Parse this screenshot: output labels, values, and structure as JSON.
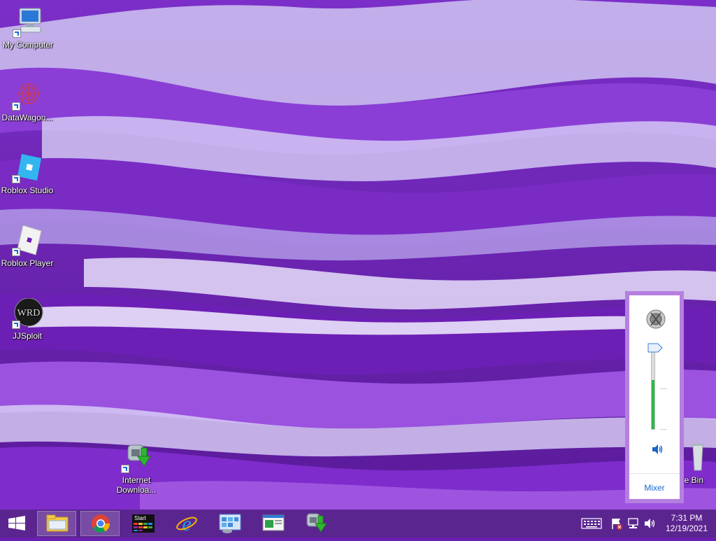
{
  "desktop": {
    "icons": [
      {
        "label": "My Computer",
        "icon": "computer-icon"
      },
      {
        "label": "DataWagon...",
        "icon": "datawagon-icon"
      },
      {
        "label": "Roblox Studio",
        "icon": "roblox-studio-icon"
      },
      {
        "label": "Roblox Player",
        "icon": "roblox-player-icon"
      },
      {
        "label": "JJSploit",
        "icon": "jjsploit-icon"
      },
      {
        "label_line1": "Internet",
        "label_line2": "Downloa...",
        "icon": "internet-download-manager-icon"
      },
      {
        "label": "e Bin",
        "icon": "recycle-bin-icon"
      }
    ]
  },
  "volume": {
    "level": 0.6,
    "mixer_label": "Mixer",
    "accent": "#2db84a"
  },
  "taskbar": {
    "items": [
      {
        "name": "file-explorer",
        "icon": "folder-icon",
        "active": true
      },
      {
        "name": "chrome",
        "icon": "chrome-icon",
        "active": true
      },
      {
        "name": "start-app",
        "icon": "start-app-icon",
        "label": "Start"
      },
      {
        "name": "internet-explorer",
        "icon": "ie-icon"
      },
      {
        "name": "control-panel",
        "icon": "control-panel-icon"
      },
      {
        "name": "window-app",
        "icon": "window-icon"
      },
      {
        "name": "download-manager",
        "icon": "internet-download-manager-icon"
      }
    ],
    "clock": {
      "time": "7:31 PM",
      "date": "12/19/2021"
    }
  },
  "colors": {
    "taskbar": "#5b2590",
    "flyout_border": "#b57fe0",
    "link": "#1a66c9"
  }
}
